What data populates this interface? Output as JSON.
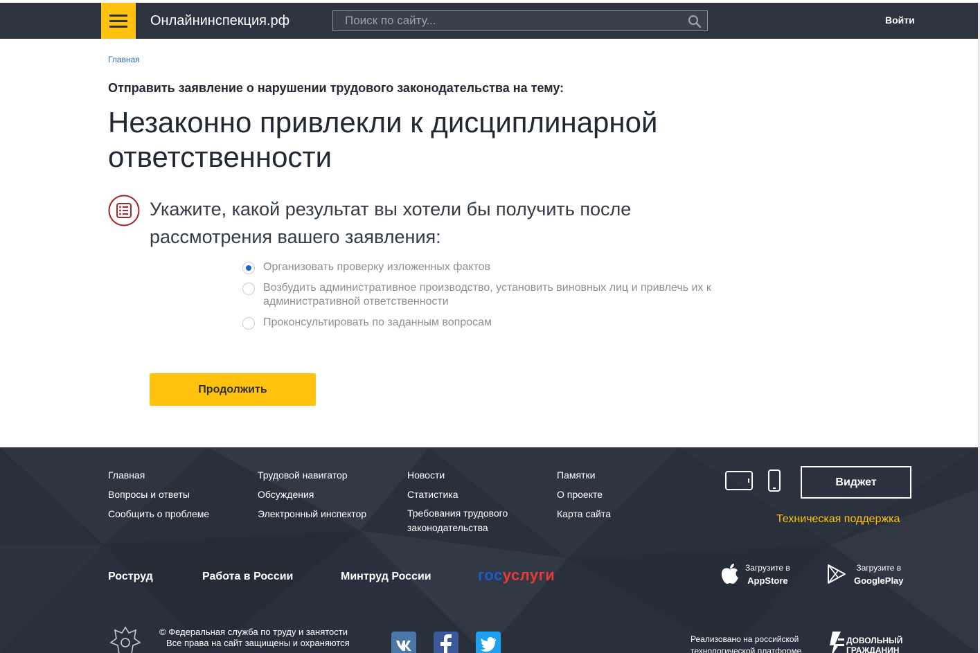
{
  "header": {
    "brand": "Онлайнинспекция.рф",
    "search_placeholder": "Поиск по сайту...",
    "login": "Войти"
  },
  "breadcrumb": "Главная",
  "subtitle": "Отправить заявление о нарушении трудового законодательства на тему:",
  "title": "Незаконно привлекли к дисциплинарной ответственности",
  "question": "Укажите, какой результат вы хотели бы получить после рассмотрения вашего заявления:",
  "options": [
    {
      "label": "Организовать проверку изложенных фактов",
      "selected": true
    },
    {
      "label": "Возбудить административное производство, установить виновных лиц и привлечь их к административной ответственности",
      "selected": false
    },
    {
      "label": "Проконсультировать по заданным вопросам",
      "selected": false
    }
  ],
  "continue_label": "Продолжить",
  "footer": {
    "col1": [
      "Главная",
      "Вопросы и ответы",
      "Сообщить о проблеме"
    ],
    "col2": [
      "Трудовой навигатор",
      "Обсуждения",
      "Электронный инспектор"
    ],
    "col3": [
      "Новости",
      "Статистика",
      "Требования трудового законодательства"
    ],
    "col4": [
      "Памятки",
      "О проекте",
      "Карта сайта"
    ],
    "widget_label": "Виджет",
    "support": "Техническая поддержка",
    "partners": [
      "Роструд",
      "Работа в России",
      "Минтруд России"
    ],
    "gosuslugi": {
      "part1": "гос",
      "part2": "услуги"
    },
    "appstore": {
      "line1": "Загрузите в",
      "line2": "AppStore"
    },
    "googleplay": {
      "line1": "Загрузите в",
      "line2": "GooglePlay"
    },
    "copyright1": "© Федеральная служба по труду и занятости",
    "copyright2": "Все права на сайт защищены и охраняются",
    "implemented1": "Реализовано на российской",
    "implemented2": "технологической платформе",
    "dovolny": "ДОВОЛЬНЫЙ ГРАЖДАНИН",
    "social": [
      "vk-icon",
      "facebook-icon",
      "twitter-icon"
    ]
  },
  "colors": {
    "header_bg": "#2d333f",
    "accent": "#ffc20e",
    "footer_bg": "#2a303b",
    "link": "#2b6cb0",
    "radio_selected": "#1a66c5"
  }
}
